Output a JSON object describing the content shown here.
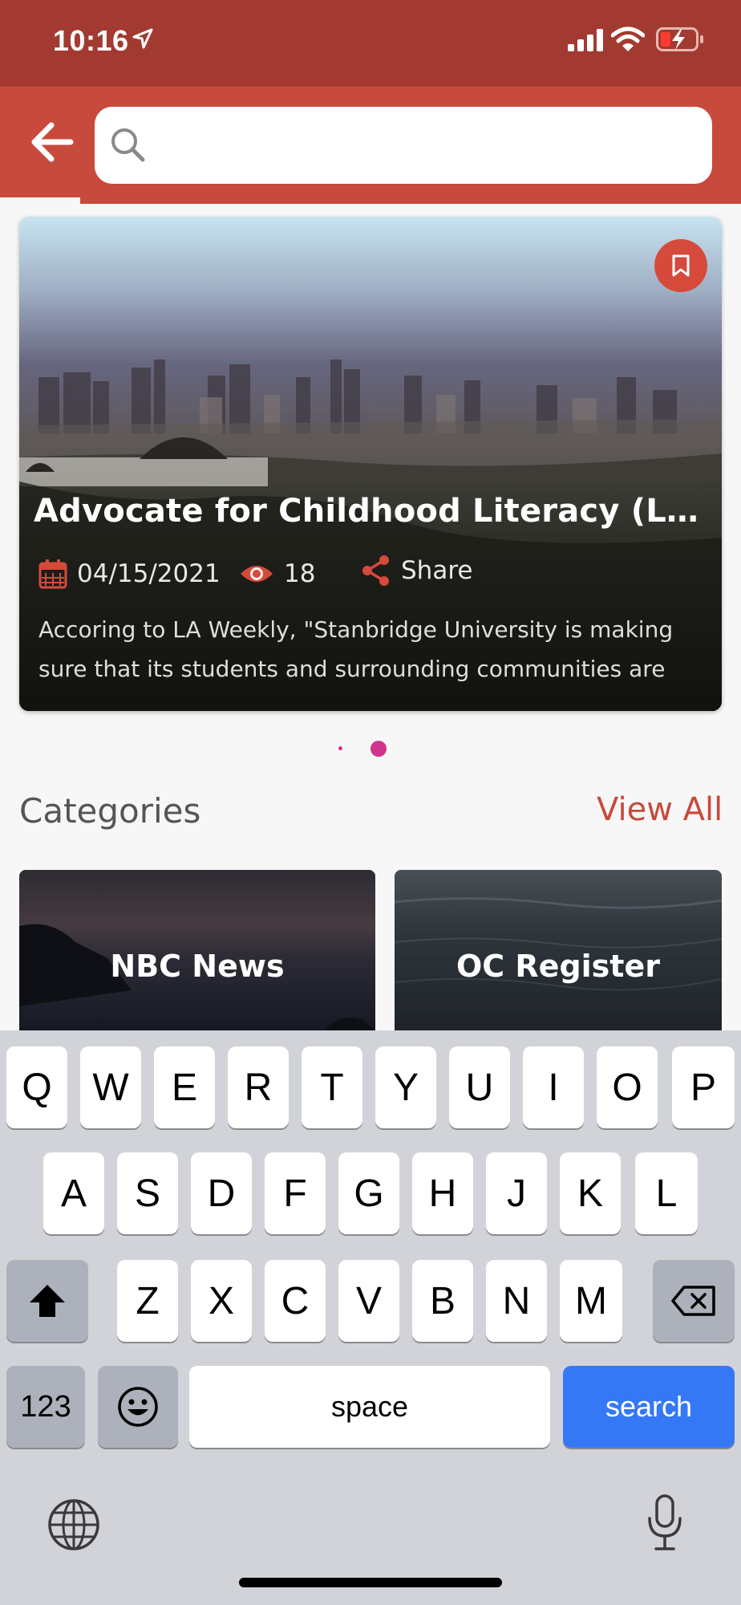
{
  "status_bar": {
    "time": "10:16"
  },
  "search": {
    "placeholder": "",
    "value": ""
  },
  "featured": {
    "title": "Advocate for Childhood Literacy (LA We…",
    "date": "04/15/2021",
    "views": "18",
    "share_label": "Share",
    "description_lines": [
      "Accoring to LA Weekly, \"Stanbridge University is making",
      "sure that its students and surrounding communities are"
    ]
  },
  "carousel": {
    "pages": 2,
    "active_page": 2
  },
  "categories": {
    "heading": "Categories",
    "view_all": "View All",
    "items": [
      {
        "label": "NBC News"
      },
      {
        "label": "OC Register"
      }
    ]
  },
  "keyboard": {
    "row1": [
      "Q",
      "W",
      "E",
      "R",
      "T",
      "Y",
      "U",
      "I",
      "O",
      "P"
    ],
    "row2": [
      "A",
      "S",
      "D",
      "F",
      "G",
      "H",
      "J",
      "K",
      "L"
    ],
    "row3": [
      "Z",
      "X",
      "C",
      "V",
      "B",
      "N",
      "M"
    ],
    "numbers_label": "123",
    "space_label": "space",
    "search_label": "search"
  },
  "colors": {
    "status_bar": "#a33a31",
    "header": "#c84a3c",
    "accent": "#c84a3c",
    "dot": "#d0348c",
    "search_key": "#3478f6"
  },
  "icons": [
    "location-arrow-icon",
    "signal-icon",
    "wifi-icon",
    "battery-charging-icon",
    "back-arrow-icon",
    "search-icon",
    "bookmark-icon",
    "calendar-icon",
    "eye-icon",
    "share-icon",
    "shift-icon",
    "backspace-icon",
    "emoji-icon",
    "globe-icon",
    "microphone-icon"
  ]
}
